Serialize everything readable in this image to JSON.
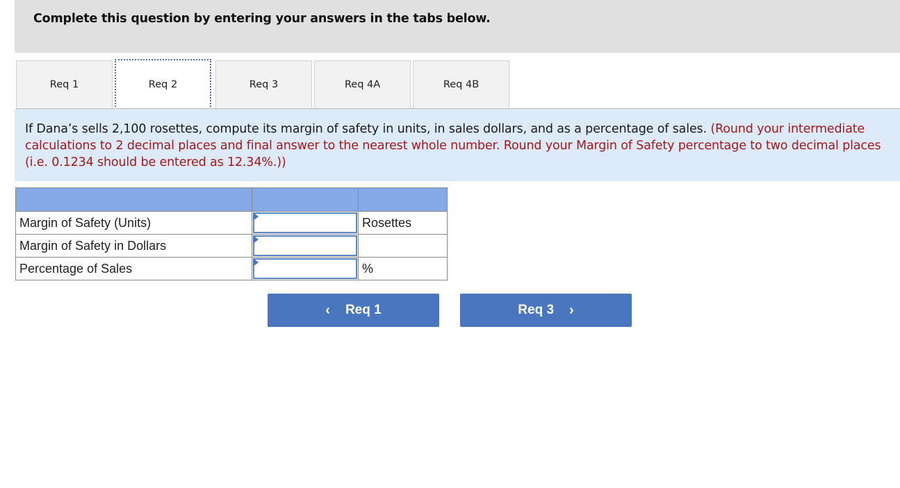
{
  "header": {
    "instruction": "Complete this question by entering your answers in the tabs below."
  },
  "tabs": [
    {
      "label": "Req 1",
      "active": false
    },
    {
      "label": "Req 2",
      "active": true
    },
    {
      "label": "Req 3",
      "active": false
    },
    {
      "label": "Req 4A",
      "active": false
    },
    {
      "label": "Req 4B",
      "active": false
    }
  ],
  "question": {
    "text": "If Dana’s sells 2,100 rosettes, compute its margin of safety in units, in sales dollars, and as a percentage of sales.",
    "note": "(Round your intermediate calculations to 2 decimal places and final answer to the nearest whole number. Round your Margin of Safety percentage to two decimal places (i.e. 0.1234 should be entered as 12.34%.))"
  },
  "table": {
    "rows": [
      {
        "label": "Margin of Safety (Units)",
        "value": "",
        "unit": "Rosettes"
      },
      {
        "label": "Margin of Safety in Dollars",
        "value": "",
        "unit": ""
      },
      {
        "label": "Percentage of Sales",
        "value": "",
        "unit": "%"
      }
    ]
  },
  "nav": {
    "prev_label": "Req 1",
    "prev_icon": "chevron-left-icon",
    "next_label": "Req 3",
    "next_icon": "chevron-right-icon"
  }
}
